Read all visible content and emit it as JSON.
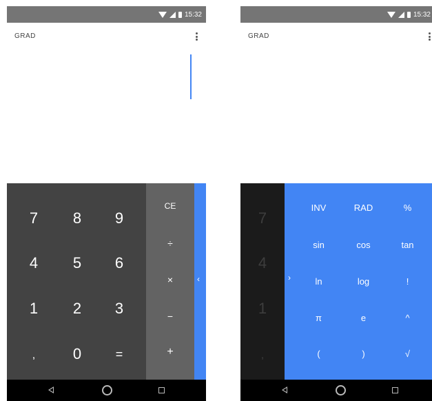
{
  "status": {
    "time": "15:32"
  },
  "left": {
    "mode": "GRAD",
    "numpad": [
      "7",
      "8",
      "9",
      "4",
      "5",
      "6",
      "1",
      "2",
      "3",
      ",",
      "0",
      "="
    ],
    "operators": [
      "CE",
      "÷",
      "×",
      "−",
      "+"
    ],
    "peek_chevron": "‹"
  },
  "right": {
    "mode": "GRAD",
    "numpad_dim": [
      "7",
      "4",
      "1",
      ","
    ],
    "expand_chevron": "›",
    "advanced": [
      "INV",
      "RAD",
      "%",
      "sin",
      "cos",
      "tan",
      "ln",
      "log",
      "!",
      "π",
      "e",
      "^",
      "(",
      ")",
      "√"
    ]
  },
  "icons": [
    "wifi-icon",
    "cell-signal-icon",
    "battery-icon",
    "overflow-menu-icon",
    "back-icon",
    "home-icon",
    "recents-icon"
  ],
  "colors": {
    "accent": "#4285f4",
    "numpad": "#434343",
    "operators": "#636363",
    "statusbar": "#757575"
  }
}
